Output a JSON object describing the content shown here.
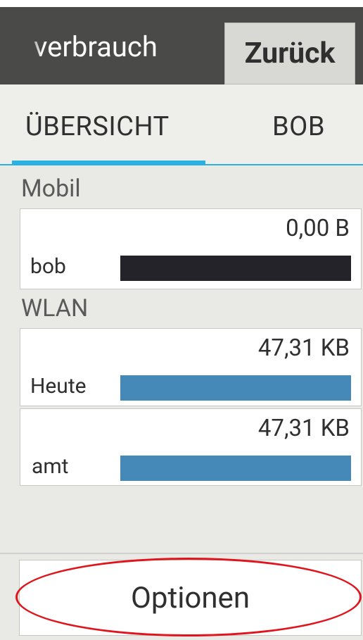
{
  "action_bar": {
    "title": "verbrauch",
    "back_label": "Zurück"
  },
  "tabs": [
    {
      "label": "ÜBERSICHT",
      "selected": true
    },
    {
      "label": "BOB",
      "selected": false
    }
  ],
  "mobile": {
    "section_label": "Mobil",
    "row": {
      "amount": "0,00 B",
      "label": "bob"
    }
  },
  "wlan": {
    "section_label": "WLAN",
    "rows": [
      {
        "amount": "47,31 KB",
        "label": "Heute"
      },
      {
        "amount": "47,31 KB",
        "label": "amt"
      }
    ]
  },
  "footer": {
    "options_label": "Optionen"
  },
  "colors": {
    "accent": "#2ab0e2",
    "bar_mobile": "#25232a",
    "bar_wlan": "#4589b8",
    "highlight": "#e0141c"
  }
}
